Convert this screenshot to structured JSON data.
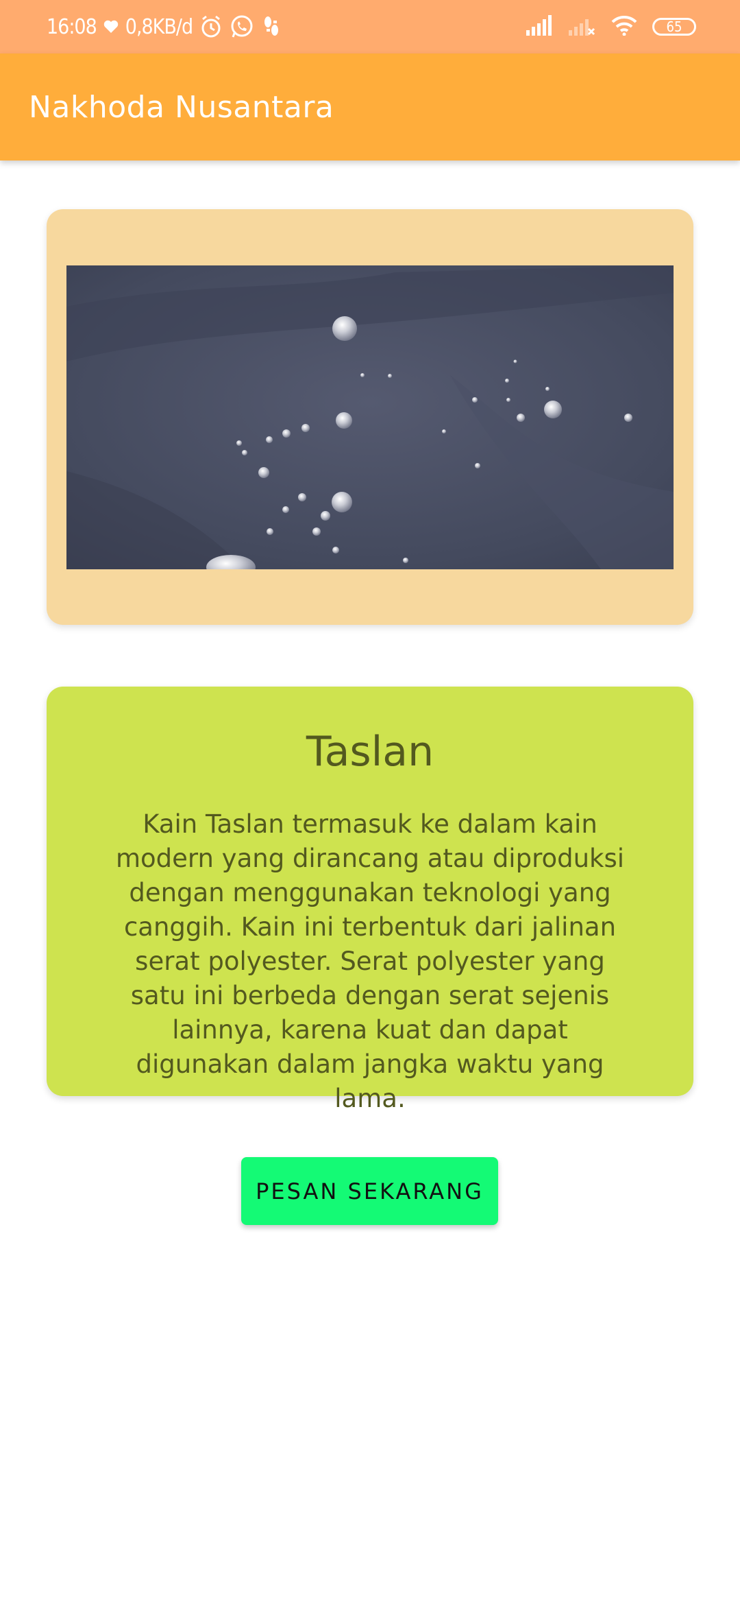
{
  "status_bar": {
    "time": "16:08",
    "speed": "0,8KB/d",
    "battery": "65",
    "icons": [
      "heart-icon",
      "alarm-icon",
      "whatsapp-icon",
      "footprint-icon",
      "signal-icon",
      "signal-empty-icon",
      "wifi-icon",
      "battery-icon"
    ]
  },
  "app_bar": {
    "title": "Nakhoda Nusantara"
  },
  "image_card": {
    "image_description": "water-droplets-on-fabric"
  },
  "description": {
    "title": "Taslan",
    "body": "Kain Taslan termasuk ke dalam kain modern yang dirancang atau diproduksi dengan menggunakan teknologi yang canggih. Kain ini terbentuk dari jalinan serat polyester. Serat polyester yang satu ini berbeda dengan serat sejenis lainnya, karena kuat dan dapat digunakan dalam jangka waktu yang lama."
  },
  "actions": {
    "order_label": "PESAN SEKARANG"
  },
  "colors": {
    "status_bar": "#ffab6e",
    "app_bar": "#ffad3b",
    "image_card": "#f7d89e",
    "desc_card": "#cee34f",
    "desc_text": "#53591f",
    "button": "#14fa75"
  }
}
